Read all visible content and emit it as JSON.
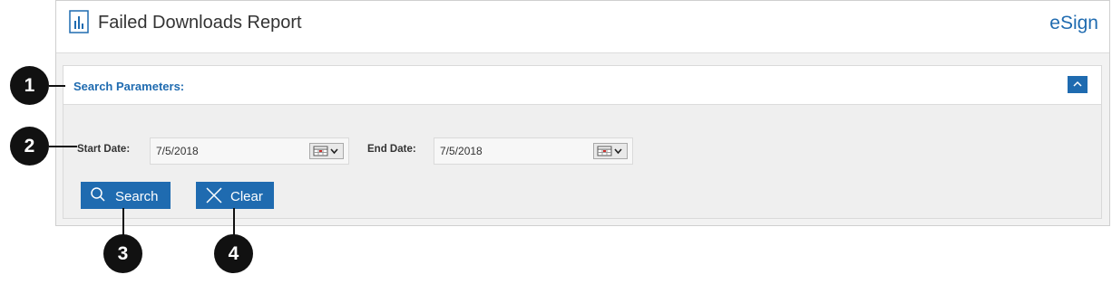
{
  "header": {
    "title": "Failed Downloads Report",
    "app_name": "eSign",
    "report_icon": "bar-chart-icon"
  },
  "search_params": {
    "title": "Search Parameters:",
    "collapse_icon": "chevron-up-icon",
    "start_date": {
      "label": "Start Date:",
      "value": "7/5/2018",
      "icon": "calendar-icon"
    },
    "end_date": {
      "label": "End Date:",
      "value": "7/5/2018",
      "icon": "calendar-icon"
    },
    "search_button": {
      "label": "Search",
      "icon": "search-icon"
    },
    "clear_button": {
      "label": "Clear",
      "icon": "close-icon"
    }
  },
  "callouts": [
    "1",
    "2",
    "3",
    "4"
  ],
  "colors": {
    "accent": "#1f6bb0",
    "panel": "#f2f2f2",
    "callout": "#111111"
  }
}
